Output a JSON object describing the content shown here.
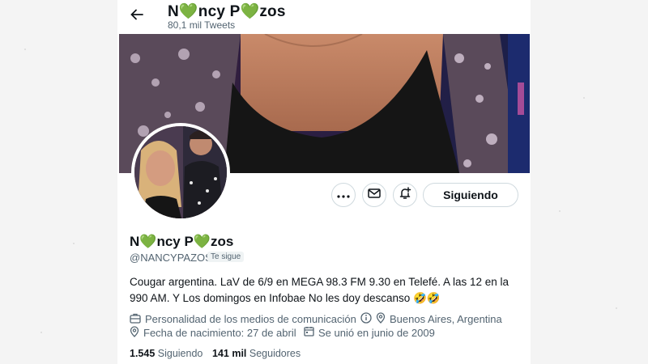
{
  "header": {
    "back_icon": "arrow-left-icon",
    "name_part1": "N",
    "name_part2": "ncy P",
    "name_part3": "zos",
    "heart_icon": "green-heart-icon",
    "tweet_count": "80,1 mil Tweets"
  },
  "profile": {
    "name_part1": "N",
    "name_part2": "ncy P",
    "name_part3": "zos",
    "handle": "@NANCYPAZOS",
    "follows_you": "Te sigue",
    "bio": "Cougar argentina. LaV de 6/9 en MEGA 98.3 FM 9.30 en Telefé. A las 12 en la 990 AM. Y Los domingos en Infobae No les doy descanso 🤣🤣",
    "category": "Personalidad de los medios de comunicación",
    "location": "Buenos Aires, Argentina",
    "birthday": "Fecha de nacimiento: 27 de abril",
    "joined": "Se unió en junio de 2009",
    "following_count": "1.545",
    "following_label": "Siguiendo",
    "followers_count": "141 mil",
    "followers_label": "Seguidores"
  },
  "actions": {
    "more_icon": "more-icon",
    "message_icon": "mail-icon",
    "notify_icon": "bell-plus-icon",
    "follow_label": "Siguiendo"
  },
  "colors": {
    "heart": "#5cb85c",
    "secondary_text": "#536471",
    "border": "#cfd9de"
  }
}
